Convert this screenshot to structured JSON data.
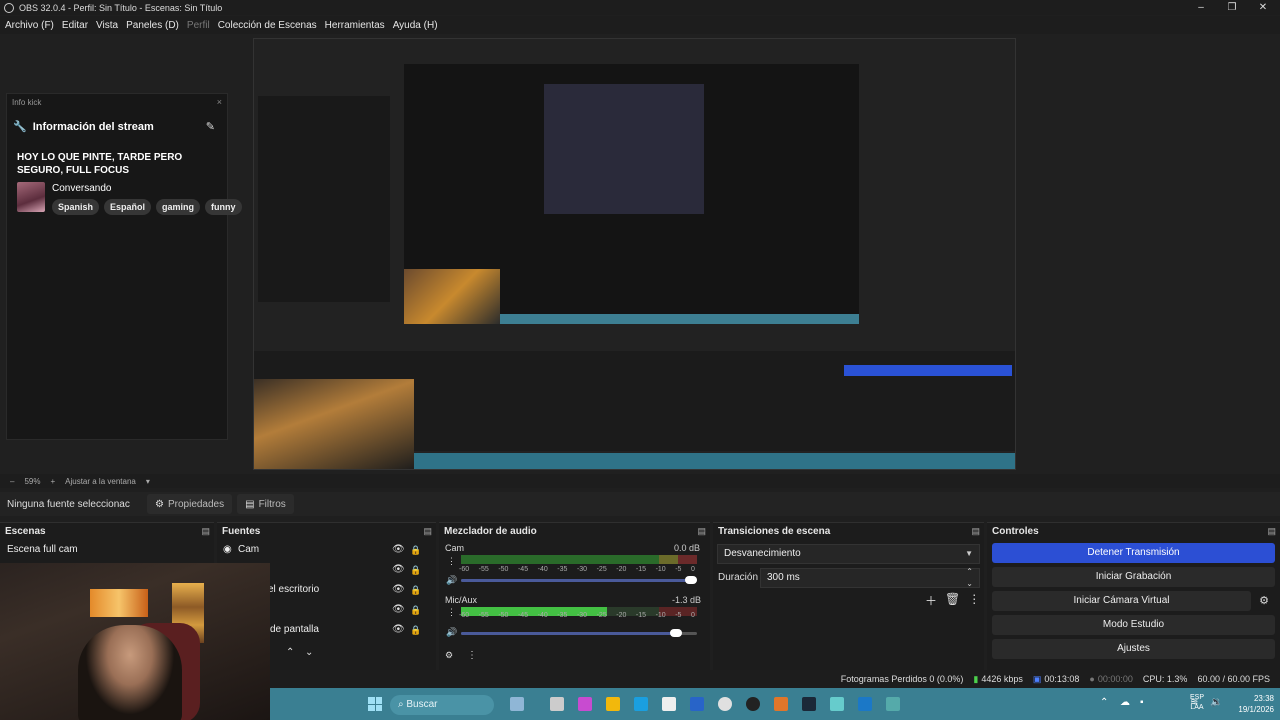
{
  "window": {
    "title": "OBS 32.0.4 - Perfil: Sin Título - Escenas: Sin Título",
    "minimize": "–",
    "maximize": "❐",
    "close": "✕"
  },
  "menu": {
    "archivo": "Archivo (F)",
    "editar": "Editar",
    "vista": "Vista",
    "paneles": "Paneles (D)",
    "perfil": "Perfil",
    "coleccion": "Colección de Escenas",
    "herramientas": "Herramientas",
    "ayuda": "Ayuda (H)"
  },
  "info_dock": {
    "dock_title": "Info kick",
    "close": "×",
    "header": "Información del stream",
    "stream_title": "HOY LO QUE PINTE, TARDE PERO SEGURO, FULL FOCUS",
    "category": "Conversando",
    "tags": [
      "Spanish",
      "Español",
      "gaming",
      "funny"
    ]
  },
  "zoom": {
    "minus": "–",
    "percent": "59%",
    "plus": "+",
    "fit": "Ajustar a la ventana"
  },
  "context": {
    "no_source": "Ninguna fuente seleccionac",
    "properties": "Propiedades",
    "filters": "Filtros"
  },
  "scenes": {
    "header": "Escenas",
    "items": [
      "Escena full cam"
    ]
  },
  "sources": {
    "header": "Fuentes",
    "items": [
      "Cam",
      "",
      "el escritorio",
      "",
      "de pantalla"
    ]
  },
  "mixer": {
    "header": "Mezclador de audio",
    "channels": [
      {
        "name": "Cam",
        "db": "0.0 dB",
        "level": 0.0
      },
      {
        "name": "Mic/Aux",
        "db": "-1.3 dB",
        "level": 0.62
      }
    ],
    "scale": [
      "-60",
      "-55",
      "-50",
      "-45",
      "-40",
      "-35",
      "-30",
      "-25",
      "-20",
      "-15",
      "-10",
      "-5",
      "0"
    ]
  },
  "transitions": {
    "header": "Transiciones de escena",
    "selected": "Desvanecimiento",
    "duration_label": "Duración",
    "duration_value": "300 ms"
  },
  "controls": {
    "header": "Controles",
    "stop_stream": "Detener Transmisión",
    "start_recording": "Iniciar Grabación",
    "start_virtual_cam": "Iniciar Cámara Virtual",
    "studio_mode": "Modo Estudio",
    "settings": "Ajustes"
  },
  "status": {
    "dropped_frames": "Fotogramas Perdidos 0 (0.0%)",
    "bitrate": "4426 kbps",
    "stream_time": "00:13:08",
    "rec_time": "00:00:00",
    "cpu": "CPU: 1.3%",
    "fps": "60.00 / 60.00 FPS"
  },
  "taskbar": {
    "search": "Buscar",
    "lang_top": "ESP",
    "lang_bottom": "LAA",
    "time": "23:38",
    "date": "19/1/2026"
  },
  "colors": {
    "accent": "#2c4fd4",
    "panel": "#1c1c1c",
    "taskbar": "#3a7f92"
  }
}
